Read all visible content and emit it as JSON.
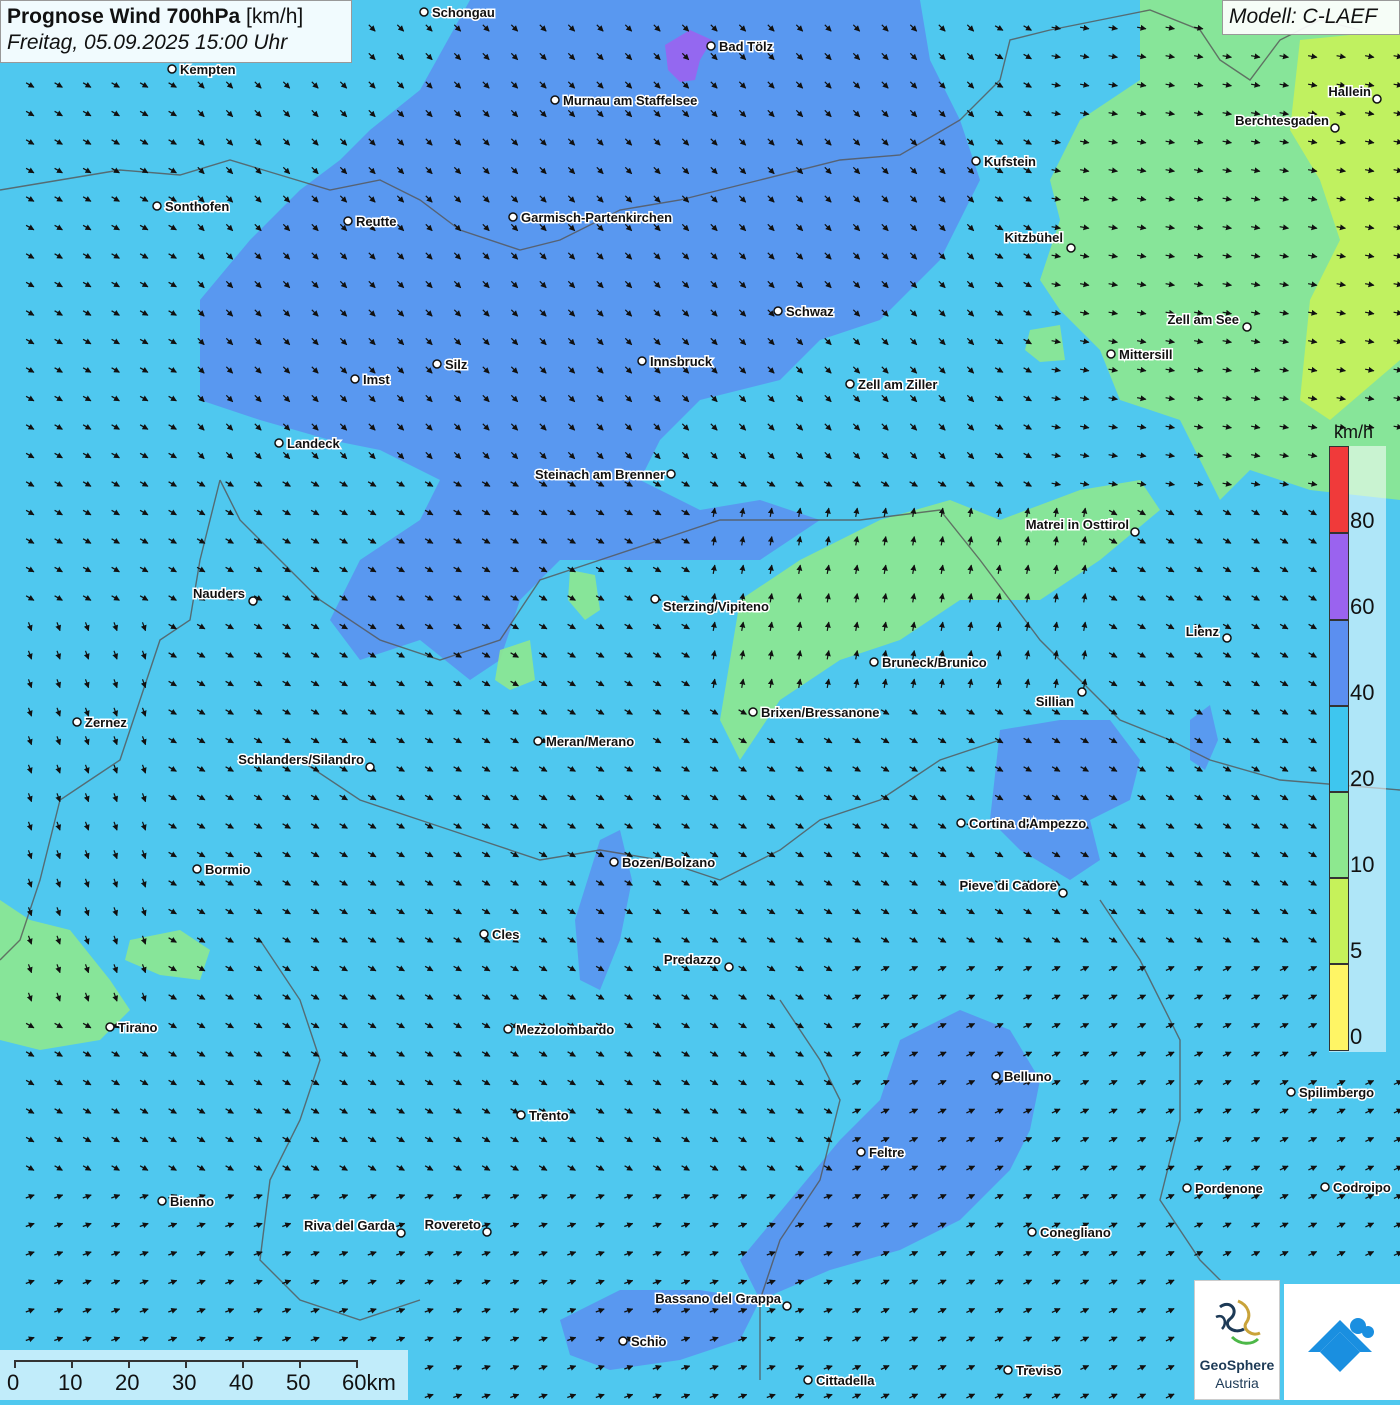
{
  "header": {
    "title_bold": "Prognose Wind 700hPa",
    "title_unit": "[km/h]",
    "subtitle": "Freitag, 05.09.2025 15:00 Uhr",
    "model": "Modell: C-LAEF"
  },
  "legend": {
    "unit": "km/h",
    "bins": [
      {
        "label": "0",
        "color": "#fff565"
      },
      {
        "label": "5",
        "color": "#c6f25a"
      },
      {
        "label": "10",
        "color": "#8de88f"
      },
      {
        "label": "20",
        "color": "#3ec6ef"
      },
      {
        "label": "40",
        "color": "#5b8ff0"
      },
      {
        "label": "60",
        "color": "#9a63ef"
      },
      {
        "label": "80",
        "color": "#f03a3a"
      }
    ]
  },
  "map_colors": {
    "base": "#4fc8ef",
    "band_20_40": "#5b8ff0",
    "band_10_20": "#8de88f",
    "band_5_10": "#c6f25a",
    "band_60_80": "#9a63ef"
  },
  "scale_bar": {
    "labels": [
      "0",
      "10",
      "20",
      "30",
      "40",
      "50",
      "60km"
    ]
  },
  "cities": [
    {
      "name": "Schongau"
    },
    {
      "name": "Bad Tölz"
    },
    {
      "name": "Kempten"
    },
    {
      "name": "Murnau am Staffelsee"
    },
    {
      "name": "Hallein"
    },
    {
      "name": "Berchtesgaden"
    },
    {
      "name": "Kufstein"
    },
    {
      "name": "Sonthofen"
    },
    {
      "name": "Reutte"
    },
    {
      "name": "Garmisch-Partenkirchen"
    },
    {
      "name": "Kitzbühel"
    },
    {
      "name": "Schwaz"
    },
    {
      "name": "Zell am See"
    },
    {
      "name": "Mittersill"
    },
    {
      "name": "Silz"
    },
    {
      "name": "Innsbruck"
    },
    {
      "name": "Imst"
    },
    {
      "name": "Zell am Ziller"
    },
    {
      "name": "Landeck"
    },
    {
      "name": "Steinach am Brenner"
    },
    {
      "name": "Matrei in Osttirol"
    },
    {
      "name": "Nauders"
    },
    {
      "name": "Sterzing/Vipiteno"
    },
    {
      "name": "Lienz"
    },
    {
      "name": "Bruneck/Brunico"
    },
    {
      "name": "Sillian"
    },
    {
      "name": "Zernez"
    },
    {
      "name": "Brixen/Bressanone"
    },
    {
      "name": "Meran/Merano"
    },
    {
      "name": "Schlanders/Silandro"
    },
    {
      "name": "Cortina d'Ampezzo"
    },
    {
      "name": "Bozen/Bolzano"
    },
    {
      "name": "Bormio"
    },
    {
      "name": "Pieve di Cadore"
    },
    {
      "name": "Cles"
    },
    {
      "name": "Predazzo"
    },
    {
      "name": "Tirano"
    },
    {
      "name": "Mezzolombardo"
    },
    {
      "name": "Belluno"
    },
    {
      "name": "Spilimbergo"
    },
    {
      "name": "Trento"
    },
    {
      "name": "Feltre"
    },
    {
      "name": "Pordenone"
    },
    {
      "name": "Codroipo"
    },
    {
      "name": "Bienno"
    },
    {
      "name": "Riva del Garda"
    },
    {
      "name": "Rovereto"
    },
    {
      "name": "Conegliano"
    },
    {
      "name": "Bassano del Grappa"
    },
    {
      "name": "Schio"
    },
    {
      "name": "Treviso"
    },
    {
      "name": "Cittadella"
    }
  ],
  "logos": {
    "geosphere_name": "GeoSphere",
    "geosphere_sub": "Austria"
  }
}
